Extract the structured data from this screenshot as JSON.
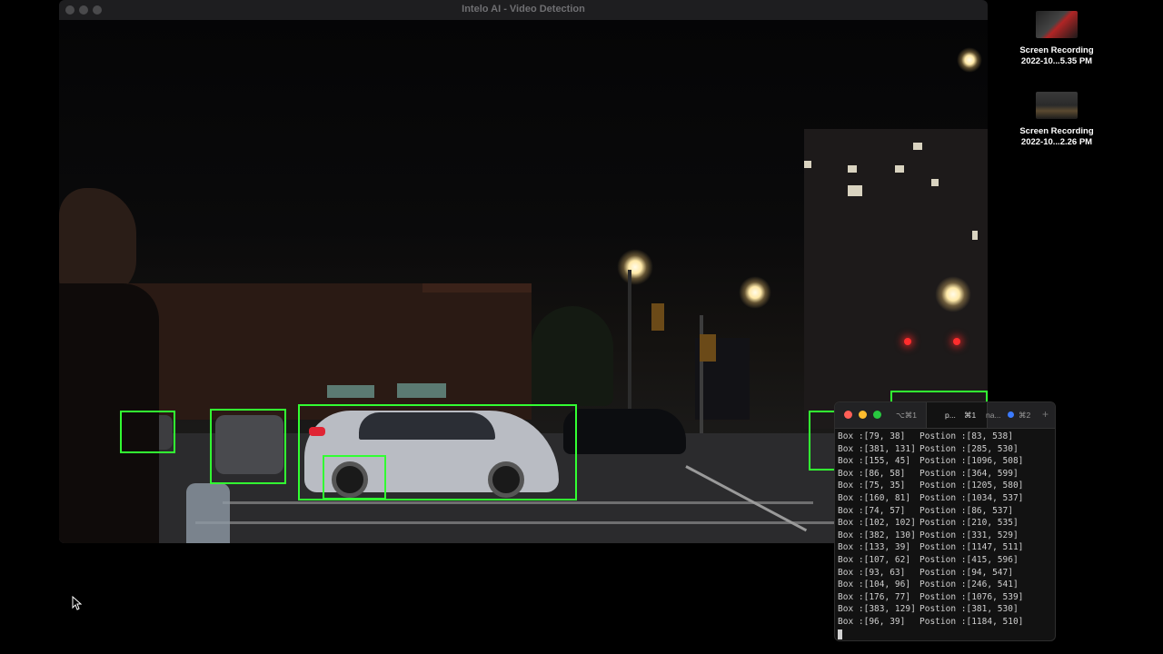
{
  "window": {
    "title": "Intelo AI - Video Detection"
  },
  "desktop": {
    "icons": [
      {
        "line1": "Screen Recording",
        "line2": "2022-10...5.35 PM"
      },
      {
        "line1": "Screen Recording",
        "line2": "2022-10...2.26 PM"
      }
    ]
  },
  "terminal": {
    "tabs": [
      {
        "label": "⌥⌘1"
      },
      {
        "label": "p...",
        "shortcut": "⌘1"
      },
      {
        "label": "na...",
        "shortcut": "⌘2"
      }
    ],
    "new_tab": "+",
    "lines": [
      {
        "box": "Box :[79, 38]",
        "pos": "Postion :[83, 538]"
      },
      {
        "box": "Box :[381, 131]",
        "pos": "Postion :[285, 530]"
      },
      {
        "box": "Box :[155, 45]",
        "pos": "Postion :[1096, 508]"
      },
      {
        "box": "Box :[86, 58]",
        "pos": "Postion :[364, 599]"
      },
      {
        "box": "Box :[75, 35]",
        "pos": "Postion :[1205, 580]"
      },
      {
        "box": "Box :[160, 81]",
        "pos": "Postion :[1034, 537]"
      },
      {
        "box": "Box :[74, 57]",
        "pos": "Postion :[86, 537]"
      },
      {
        "box": "Box :[102, 102]",
        "pos": "Postion :[210, 535]"
      },
      {
        "box": "Box :[382, 130]",
        "pos": "Postion :[331, 529]"
      },
      {
        "box": "Box :[133, 39]",
        "pos": "Postion :[1147, 511]"
      },
      {
        "box": "Box :[107, 62]",
        "pos": "Postion :[415, 596]"
      },
      {
        "box": "Box :[93, 63]",
        "pos": "Postion :[94, 547]"
      },
      {
        "box": "Box :[104, 96]",
        "pos": "Postion :[246, 541]"
      },
      {
        "box": "Box :[176, 77]",
        "pos": "Postion :[1076, 539]"
      },
      {
        "box": "Box :[383, 129]",
        "pos": "Postion :[381, 530]"
      },
      {
        "box": "Box :[96, 39]",
        "pos": "Postion :[1184, 510]"
      }
    ]
  },
  "colors": {
    "detection_box": "#32ff32",
    "close": "#ff5f57",
    "minimize": "#febc2e",
    "zoom": "#28c840",
    "tab_dot": "#3b7bff"
  }
}
